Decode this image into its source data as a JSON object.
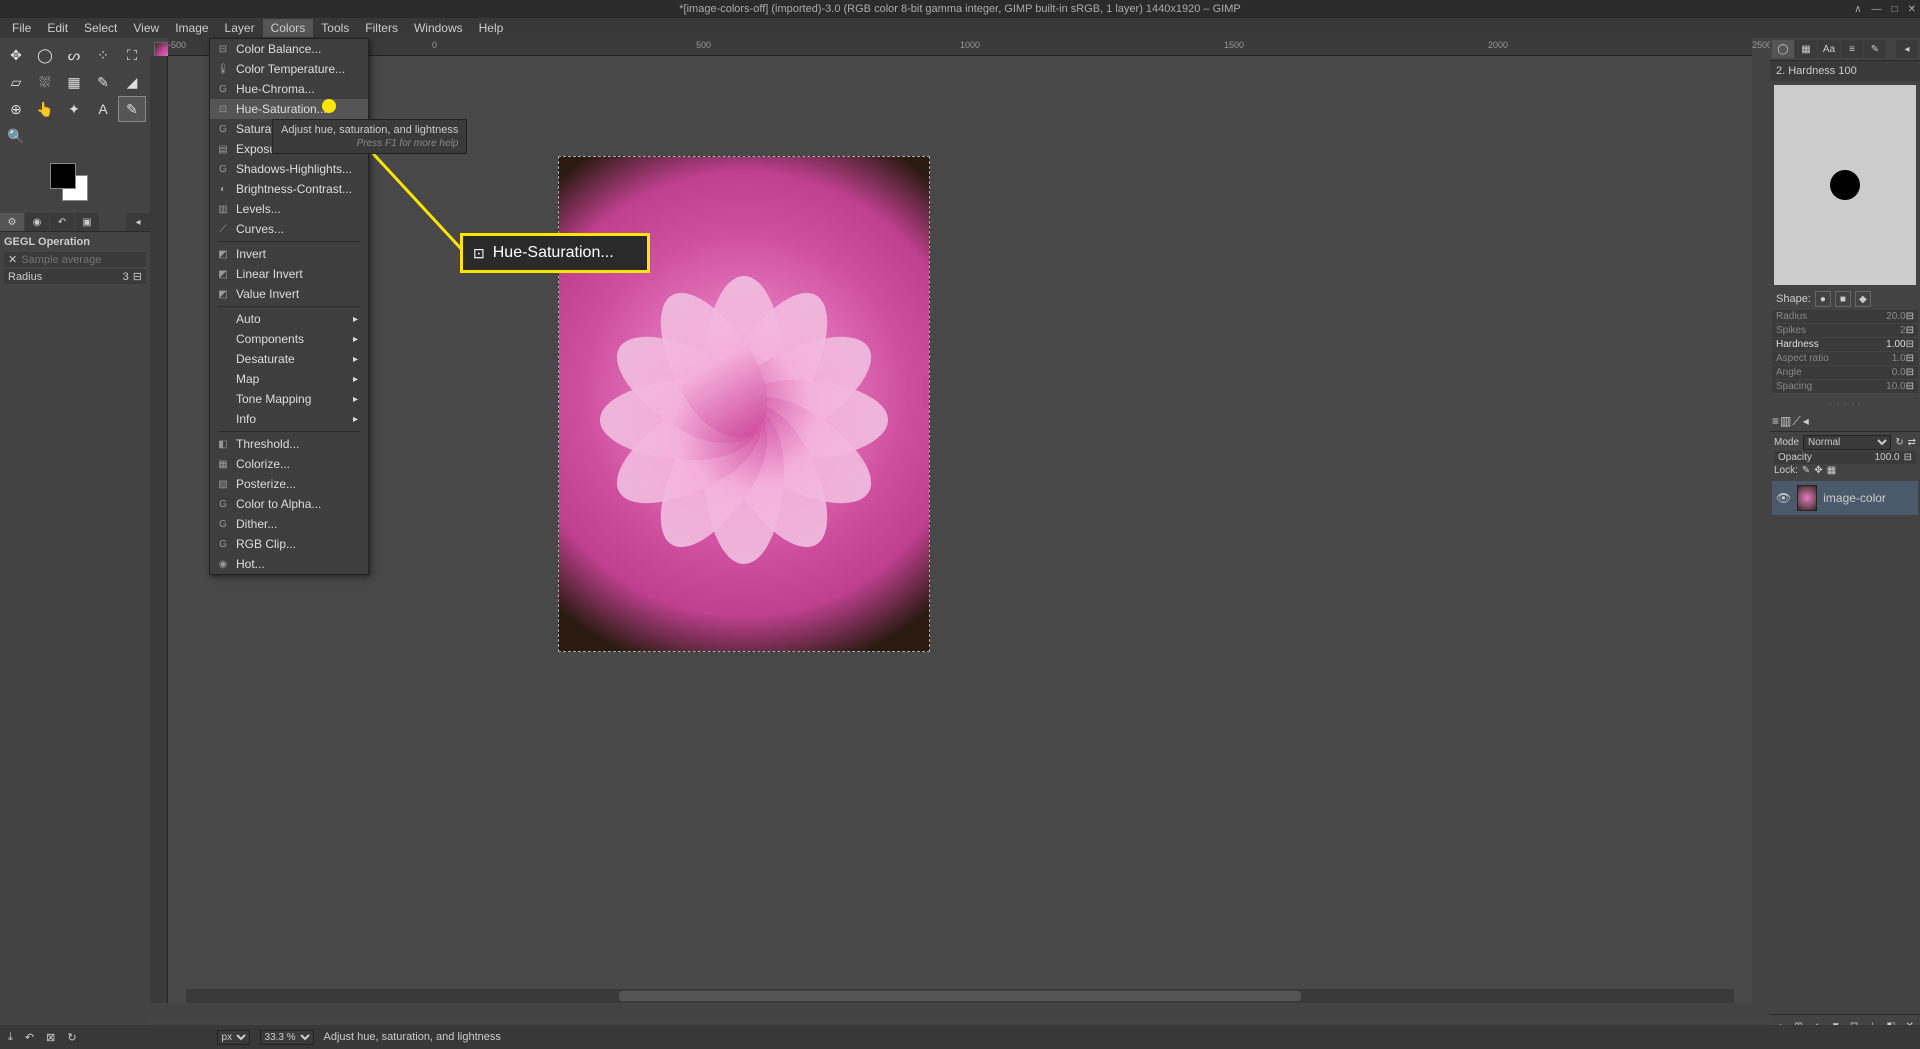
{
  "titlebar": {
    "title": "*[image-colors-off] (imported)-3.0 (RGB color 8-bit gamma integer, GIMP built-in sRGB, 1 layer) 1440x1920 – GIMP"
  },
  "menubar": {
    "items": [
      "File",
      "Edit",
      "Select",
      "View",
      "Image",
      "Layer",
      "Colors",
      "Tools",
      "Filters",
      "Windows",
      "Help"
    ],
    "active_index": 6
  },
  "dropdown": {
    "groups": [
      [
        {
          "label": "Color Balance...",
          "icon": "⊟"
        },
        {
          "label": "Color Temperature...",
          "icon": "🌡"
        },
        {
          "label": "Hue-Chroma...",
          "icon": "G"
        },
        {
          "label": "Hue-Saturation...",
          "icon": "⊡",
          "highlighted": true
        },
        {
          "label": "Saturation...",
          "icon": "G"
        },
        {
          "label": "Exposure...",
          "icon": "▤"
        },
        {
          "label": "Shadows-Highlights...",
          "icon": "G"
        },
        {
          "label": "Brightness-Contrast...",
          "icon": "◐"
        },
        {
          "label": "Levels...",
          "icon": "▥"
        },
        {
          "label": "Curves...",
          "icon": "⟋"
        }
      ],
      [
        {
          "label": "Invert",
          "icon": "◩"
        },
        {
          "label": "Linear Invert",
          "icon": "◩"
        },
        {
          "label": "Value Invert",
          "icon": "◩"
        }
      ],
      [
        {
          "label": "Auto",
          "submenu": true
        },
        {
          "label": "Components",
          "submenu": true
        },
        {
          "label": "Desaturate",
          "submenu": true
        },
        {
          "label": "Map",
          "submenu": true
        },
        {
          "label": "Tone Mapping",
          "submenu": true
        },
        {
          "label": "Info",
          "submenu": true
        }
      ],
      [
        {
          "label": "Threshold...",
          "icon": "◧"
        },
        {
          "label": "Colorize...",
          "icon": "▦"
        },
        {
          "label": "Posterize...",
          "icon": "▨"
        },
        {
          "label": "Color to Alpha...",
          "icon": "G"
        },
        {
          "label": "Dither...",
          "icon": "G"
        },
        {
          "label": "RGB Clip...",
          "icon": "G"
        },
        {
          "label": "Hot...",
          "icon": "◉"
        }
      ]
    ]
  },
  "tooltip": {
    "text": "Adjust hue, saturation, and lightness",
    "hint": "Press F1 for more help"
  },
  "callout": {
    "label": "Hue-Saturation..."
  },
  "tool_options": {
    "header": "GEGL Operation",
    "sample_label": "Sample average",
    "radius_label": "Radius",
    "radius_value": "3"
  },
  "ruler_h": [
    "-500",
    "0",
    "500",
    "1000",
    "1500",
    "2000",
    "2500"
  ],
  "brush": {
    "header": "2. Hardness 100",
    "shape_label": "Shape:",
    "sliders": [
      {
        "label": "Radius",
        "value": "20.0",
        "enabled": false
      },
      {
        "label": "Spikes",
        "value": "2",
        "enabled": false
      },
      {
        "label": "Hardness",
        "value": "1.00",
        "enabled": true
      },
      {
        "label": "Aspect ratio",
        "value": "1.0",
        "enabled": false
      },
      {
        "label": "Angle",
        "value": "0.0",
        "enabled": false
      },
      {
        "label": "Spacing",
        "value": "10.0",
        "enabled": false
      }
    ]
  },
  "layers": {
    "mode_label": "Mode",
    "mode_value": "Normal",
    "opacity_label": "Opacity",
    "opacity_value": "100.0",
    "lock_label": "Lock:",
    "layer_name": "image-color"
  },
  "statusbar": {
    "unit": "px",
    "zoom": "33.3 %",
    "message": "Adjust hue, saturation, and lightness"
  }
}
